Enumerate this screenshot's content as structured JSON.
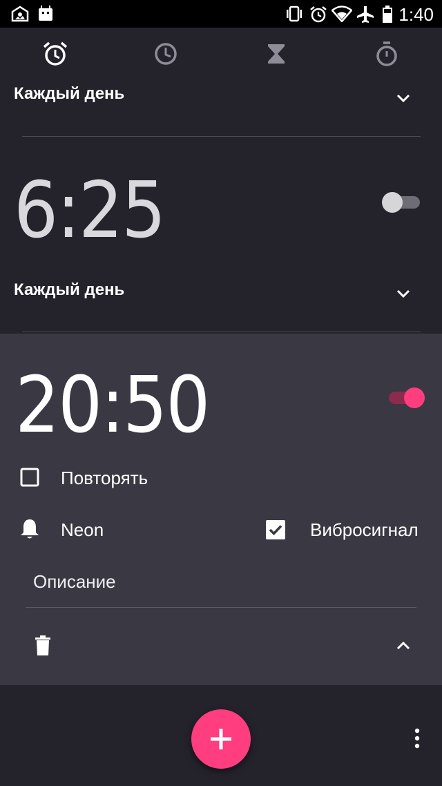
{
  "status_bar": {
    "time": "1:40",
    "icons": [
      "photo-notification-icon",
      "android-notification-icon",
      "vibrate-icon",
      "alarm-icon",
      "wifi-icon",
      "airplane-mode-icon",
      "battery-icon"
    ]
  },
  "tabs": [
    {
      "name": "alarm",
      "icon": "alarm-icon",
      "active": true
    },
    {
      "name": "clock",
      "icon": "clock-icon",
      "active": false
    },
    {
      "name": "timer",
      "icon": "hourglass-icon",
      "active": false
    },
    {
      "name": "stopwatch",
      "icon": "stopwatch-icon",
      "active": false
    }
  ],
  "alarms": [
    {
      "repeat_label": "Каждый день",
      "expanded": false
    },
    {
      "time": "6:25",
      "enabled": false,
      "repeat_label": "Каждый день",
      "expanded": false
    },
    {
      "time": "20:50",
      "enabled": true,
      "expanded": true,
      "repeat": {
        "label": "Повторять",
        "checked": false
      },
      "ringtone": "Neon",
      "vibrate": {
        "label": "Вибросигнал",
        "checked": true
      },
      "description_placeholder": "Описание"
    }
  ],
  "colors": {
    "accent": "#ff3d7f",
    "background": "#24222b",
    "expanded_card": "#3a3842",
    "status_bar": "#000000"
  }
}
